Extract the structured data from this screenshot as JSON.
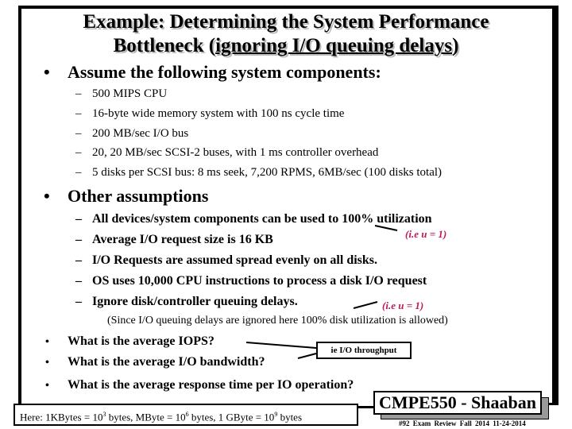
{
  "slide": {
    "title_line1": "Example: Determining the System Performance",
    "title_line2_prefix": "Bottleneck (",
    "title_line2_underlined": "ignoring I/O queuing delays",
    "title_line2_suffix": ")",
    "section1": {
      "bullet": "•",
      "heading": "Assume the following system components:",
      "items": [
        "500 MIPS CPU",
        "16-byte wide memory system with 100 ns cycle time",
        "200 MB/sec  I/O bus",
        "20,  20 MB/sec SCSI-2 buses, with 1 ms controller overhead",
        "5 disks per SCSI  bus: 8 ms seek, 7,200 RPMS, 6MB/sec  (100 disks total)"
      ]
    },
    "section2": {
      "bullet": "•",
      "heading": "Other assumptions",
      "items": [
        "All devices/system components can be used to 100% utilization",
        "Average I/O request size is 16 KB",
        "I/O Requests are assumed spread evenly on all disks.",
        "OS uses 10,000 CPU instructions to process a disk I/O request",
        "Ignore disk/controller queuing delays."
      ],
      "note1": "(i.e  u = 1)",
      "note2": "(i.e  u = 1)",
      "since_note": "(Since I/O queuing delays are ignored here 100% disk utilization is allowed)"
    },
    "dash": "–",
    "questions": [
      "What is the average IOPS?",
      "What is the average I/O bandwidth?",
      "What is the average response time per IO operation?"
    ],
    "callout": "ie  I/O throughput",
    "units_note": {
      "prefix": "Here:  1KBytes = 10",
      "exp1": "3",
      "mid1": " bytes,  MByte = 10",
      "exp2": "6",
      "mid2": " bytes,    1 GByte = 10",
      "exp3": "9",
      "suffix": " bytes"
    },
    "badge": "CMPE550 - Shaaban",
    "footer": "#92   Exam Review   Fall 2014   11-24-2014",
    "colors": {
      "note": "#c0185a",
      "shadow": "#999999"
    }
  }
}
